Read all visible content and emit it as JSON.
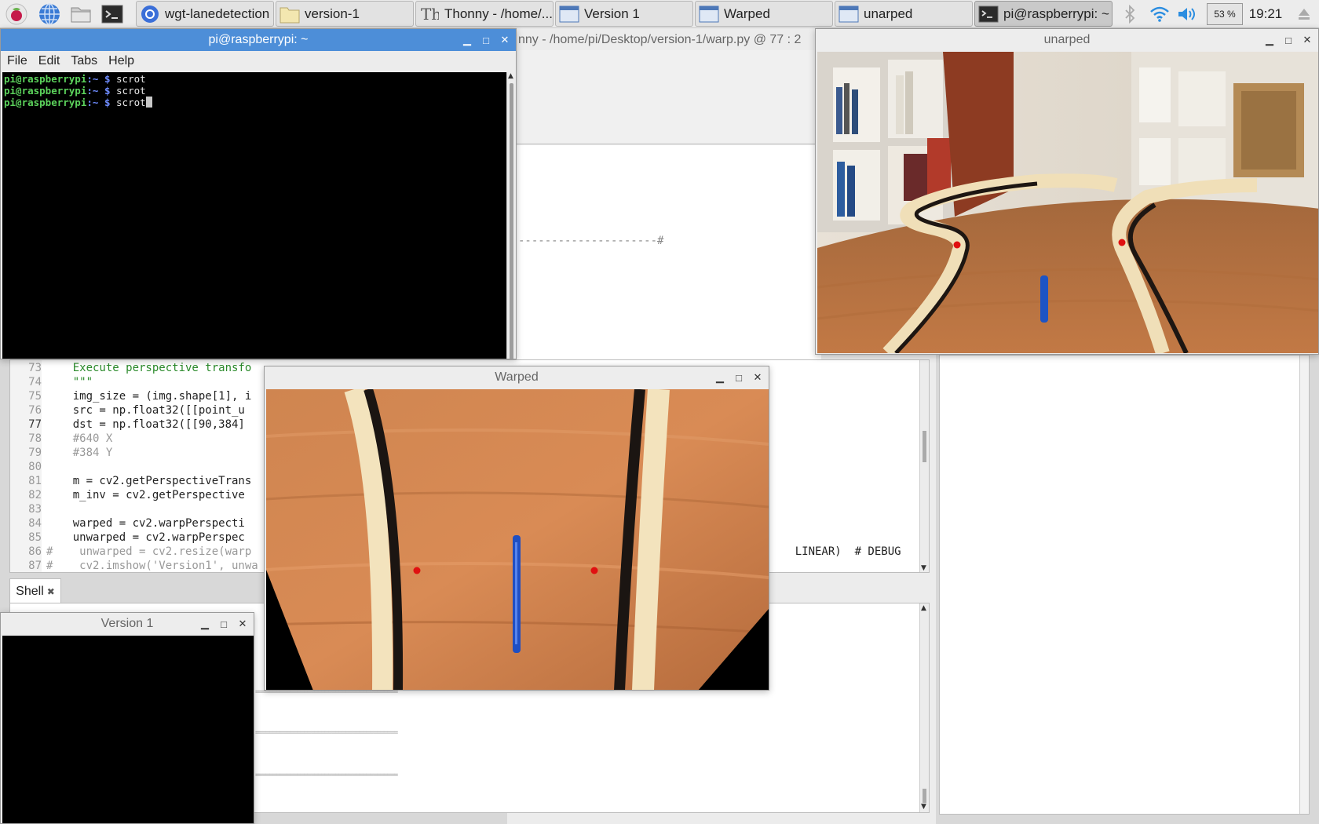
{
  "taskbar": {
    "tasks": [
      {
        "label": "wgt-lanedetection ..."
      },
      {
        "label": "version-1"
      },
      {
        "label": "Thonny  -  /home/..."
      },
      {
        "label": "Version 1"
      },
      {
        "label": "Warped"
      },
      {
        "label": "unarped"
      },
      {
        "label": "pi@raspberrypi: ~"
      }
    ],
    "battery": "53 %",
    "clock": "19:21"
  },
  "terminal": {
    "title": "pi@raspberrypi: ~",
    "menu": [
      "File",
      "Edit",
      "Tabs",
      "Help"
    ],
    "lines": [
      {
        "user": "pi@raspberrypi",
        "path": ":~",
        "dollar": "$",
        "cmd": "scrot"
      },
      {
        "user": "pi@raspberrypi",
        "path": ":~",
        "dollar": "$",
        "cmd": "scrot"
      },
      {
        "user": "pi@raspberrypi",
        "path": ":~",
        "dollar": "$",
        "cmd": "scrot"
      }
    ]
  },
  "thonny": {
    "title_fragment": "nny  -  /home/pi/Desktop/version-1/warp.py  @  77 : 2",
    "dashes": "---------------------#",
    "code_lines": [
      {
        "n": "73",
        "text": "    Execute perspective transfo"
      },
      {
        "n": "74",
        "text": "    \"\"\""
      },
      {
        "n": "75",
        "text": "    img_size = (img.shape[1], i"
      },
      {
        "n": "76",
        "text": "    src = np.float32([[point_u"
      },
      {
        "n": "77",
        "text": "    dst = np.float32([[90,384]"
      },
      {
        "n": "78",
        "text": "    #640 X"
      },
      {
        "n": "79",
        "text": "    #384 Y"
      },
      {
        "n": "80",
        "text": ""
      },
      {
        "n": "81",
        "text": "    m = cv2.getPerspectiveTrans"
      },
      {
        "n": "82",
        "text": "    m_inv = cv2.getPerspective"
      },
      {
        "n": "83",
        "text": ""
      },
      {
        "n": "84",
        "text": "    warped = cv2.warpPerspecti"
      },
      {
        "n": "85",
        "text": "    unwarped = cv2.warpPerspec"
      },
      {
        "n": "86",
        "text": "#    unwarped = cv2.resize(warp"
      },
      {
        "n": "87",
        "text": "#    cv2.imshow('Version1', unwa"
      }
    ],
    "line85_tail": "LINEAR)  # DEBUG",
    "shell_tab": "Shell",
    "shell_equals": "========================================="
  },
  "unwarped_window": {
    "title": "unarped"
  },
  "warped_window": {
    "title": "Warped"
  },
  "version1_window": {
    "title": "Version 1"
  }
}
